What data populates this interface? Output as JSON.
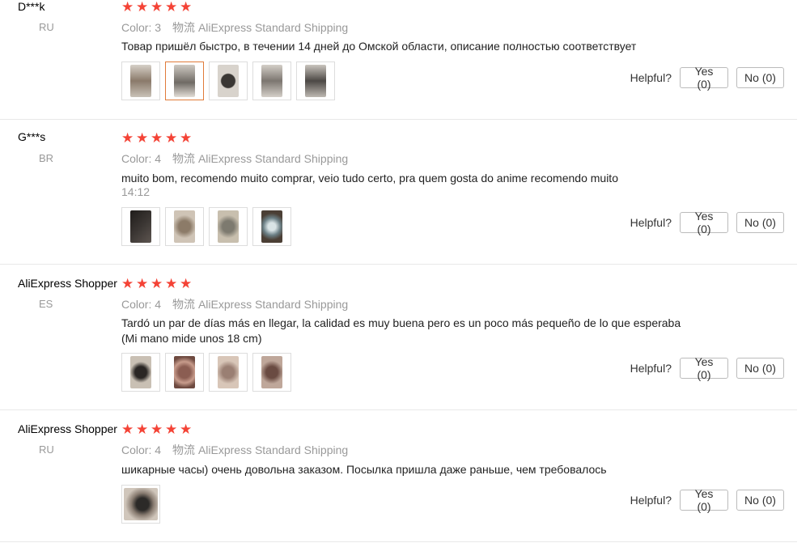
{
  "reviews": [
    {
      "name": "D***k",
      "country": "RU",
      "rating": 5,
      "color_label": "Color:",
      "color_value": "3",
      "logistics_label": "物流",
      "shipping": "AliExpress Standard Shipping",
      "text": "Товар пришёл быстро, в течении 14 дней до Омской области, описание полностью соответствует",
      "time": "",
      "photos": [
        "#8a7a6a",
        "#6f6a64",
        "#5a5652",
        "#7c7670",
        "#4c4845"
      ],
      "helpful_label": "Helpful?",
      "yes_label": "Yes (0)",
      "no_label": "No (0)"
    },
    {
      "name": "G***s",
      "country": "BR",
      "rating": 5,
      "color_label": "Color:",
      "color_value": "4",
      "logistics_label": "物流",
      "shipping": "AliExpress Standard Shipping",
      "text": "muito bom, recomendo muito comprar, veio tudo certo, pra quem gosta do anime recomendo muito",
      "time": "14:12",
      "photos": [
        "#3b3633",
        "#8c7b68",
        "#7d7a6f",
        "#6b7f85"
      ],
      "helpful_label": "Helpful?",
      "yes_label": "Yes (0)",
      "no_label": "No (0)"
    },
    {
      "name": "AliExpress Shopper",
      "country": "ES",
      "rating": 5,
      "color_label": "Color:",
      "color_value": "4",
      "logistics_label": "物流",
      "shipping": "AliExpress Standard Shipping",
      "text": "Tardó un par de días más en llegar, la calidad es muy buena pero es un poco más pequeño de lo que esperaba (Mi mano mide unos 18 cm)",
      "time": "",
      "photos": [
        "#4a4440",
        "#8b5d52",
        "#9a7f73",
        "#6a4b42"
      ],
      "helpful_label": "Helpful?",
      "yes_label": "Yes (0)",
      "no_label": "No (0)"
    },
    {
      "name": "AliExpress Shopper",
      "country": "RU",
      "rating": 5,
      "color_label": "Color:",
      "color_value": "4",
      "logistics_label": "物流",
      "shipping": "AliExpress Standard Shipping",
      "text": "шикарные часы) очень довольна заказом. Посылка пришла даже раньше, чем требовалось",
      "time": "",
      "photos": [
        "#6a6560"
      ],
      "helpful_label": "Helpful?",
      "yes_label": "Yes (0)",
      "no_label": "No (0)"
    }
  ]
}
